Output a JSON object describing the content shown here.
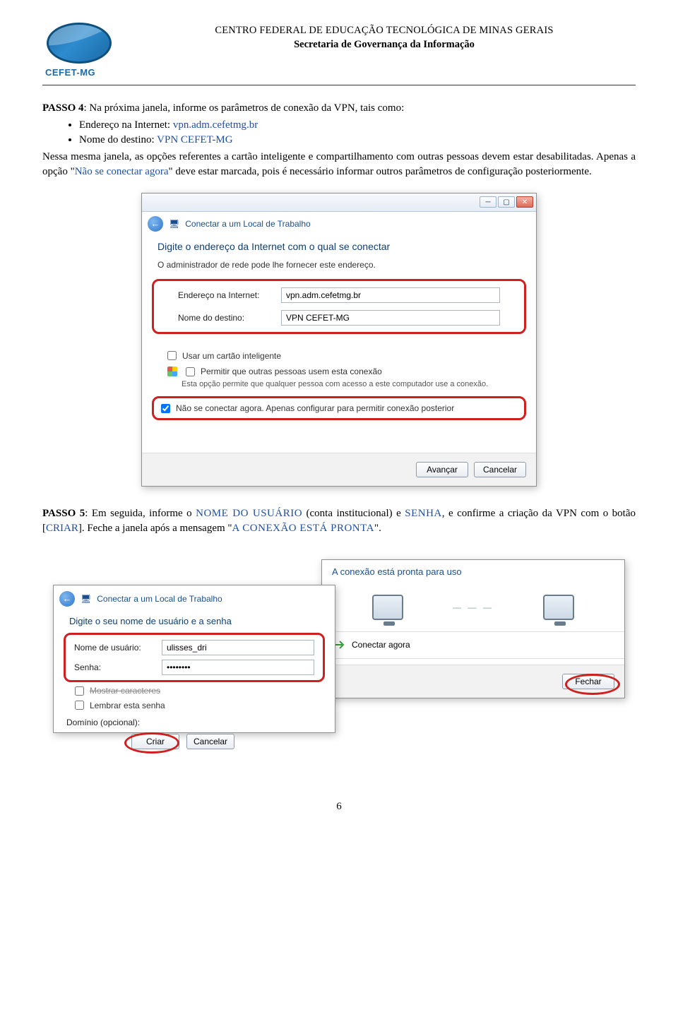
{
  "header": {
    "org_name": "CENTRO FEDERAL DE EDUCAÇÃO TECNOLÓGICA DE MINAS GERAIS",
    "org_sub": "Secretaria de Governança da Informação",
    "logo_text": "CEFET-MG"
  },
  "passo4": {
    "label": "PASSO 4",
    "intro": ": Na próxima janela, informe os parâmetros de conexão da VPN, tais como:",
    "bullets": [
      {
        "label": "Endereço na Internet: ",
        "value": "vpn.adm.cefetmg.br"
      },
      {
        "label": "Nome do destino: ",
        "value": "VPN CEFET-MG"
      }
    ],
    "cont1": "Nessa mesma janela, as opções referentes a cartão inteligente e compartilhamento com outras pessoas devem estar desabilitadas. Apenas a opção \"",
    "cont_opt": "Não se conectar agora",
    "cont2": "\" deve estar marcada, pois é necessário informar outros parâmetros de configuração posteriormente."
  },
  "dialog1": {
    "breadcrumb": "Conectar a um Local de Trabalho",
    "heading": "Digite o endereço da Internet com o qual se conectar",
    "subtext": "O administrador de rede pode lhe fornecer este endereço.",
    "field_internet_label": "Endereço na Internet:",
    "field_internet_value": "vpn.adm.cefetmg.br",
    "field_dest_label": "Nome do destino:",
    "field_dest_value": "VPN CEFET-MG",
    "chk_smartcard": "Usar um cartão inteligente",
    "chk_share": "Permitir que outras pessoas usem esta conexão",
    "chk_share_note": "Esta opção permite que qualquer pessoa com acesso a este computador use a conexão.",
    "chk_later": "Não se conectar agora. Apenas configurar para permitir conexão posterior",
    "btn_next": "Avançar",
    "btn_cancel": "Cancelar"
  },
  "passo5": {
    "label": "PASSO 5",
    "p1a": ": Em seguida, informe o ",
    "p1_user": "NOME DO USUÁRIO",
    "p1b": " (conta institucional) e ",
    "p1_pwd": "SENHA",
    "p1c": ", e confirme a criação da VPN com o botão [",
    "p1_btn": "CRIAR",
    "p1d": "]. Feche a janela após a mensagem \"",
    "p1_msg": "A CONEXÃO ESTÁ PRONTA",
    "p1e": "\"."
  },
  "dialog2_left": {
    "breadcrumb": "Conectar a um Local de Trabalho",
    "heading": "Digite o seu nome de usuário e a senha",
    "user_label": "Nome de usuário:",
    "user_value": "ulisses_dri",
    "pwd_label": "Senha:",
    "pwd_value": "••••••••",
    "chk_show": "Mostrar caracteres",
    "chk_remember": "Lembrar esta senha",
    "domain_label": "Domínio (opcional):",
    "btn_create": "Criar",
    "btn_cancel": "Cancelar"
  },
  "dialog2_right": {
    "title": "A conexão está pronta para uso",
    "action": "Conectar agora",
    "btn_close": "Fechar"
  },
  "page_number": "6"
}
